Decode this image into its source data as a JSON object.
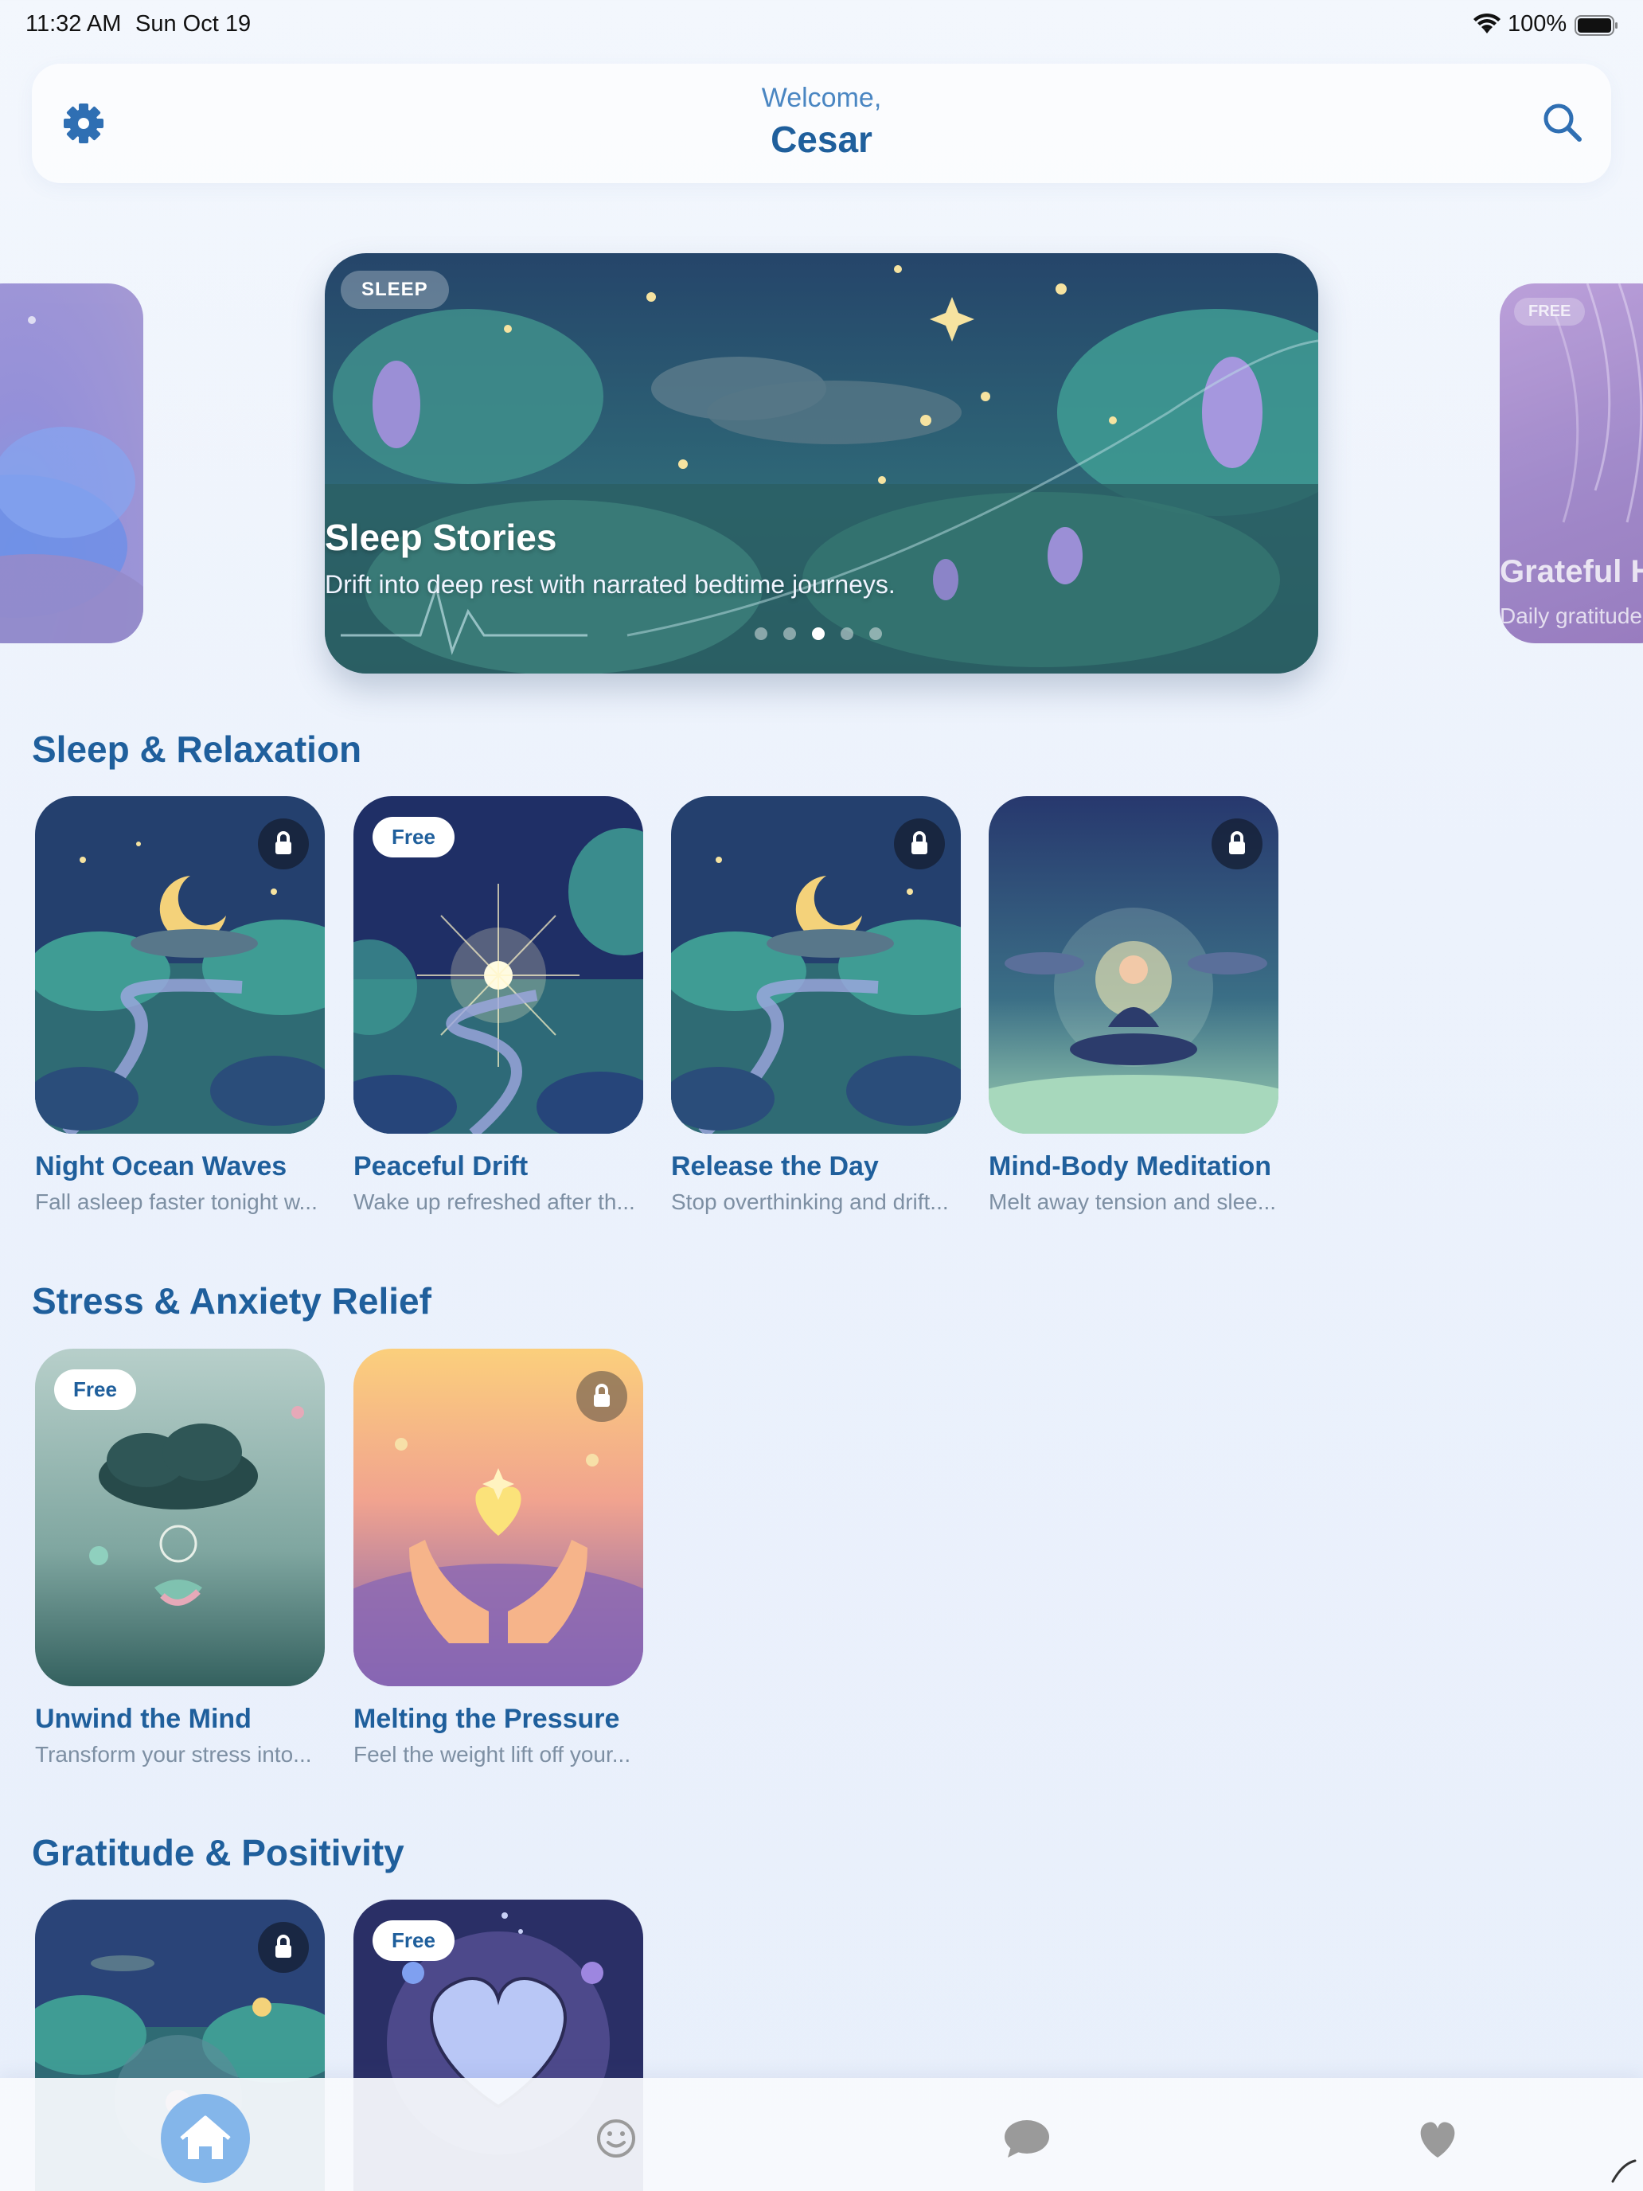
{
  "status_bar": {
    "time": "11:32 AM",
    "date": "Sun Oct 19",
    "battery": "100%"
  },
  "header": {
    "welcome": "Welcome,",
    "user_name": "Cesar"
  },
  "carousel": {
    "active_index": 2,
    "count": 5,
    "hero": {
      "badge": "SLEEP",
      "title": "Sleep Stories",
      "subtitle": "Drift into deep rest with narrated bedtime journeys."
    },
    "next": {
      "badge": "FREE",
      "title": "Grateful H",
      "subtitle": "Daily gratitude"
    }
  },
  "sections": [
    {
      "title": "Sleep & Relaxation",
      "items": [
        {
          "title": "Night Ocean Waves",
          "subtitle": "Fall asleep faster tonight w...",
          "locked": true,
          "free": false
        },
        {
          "title": "Peaceful Drift",
          "subtitle": "Wake up refreshed after th...",
          "locked": false,
          "free": true
        },
        {
          "title": "Release the Day",
          "subtitle": "Stop overthinking and drift...",
          "locked": true,
          "free": false
        },
        {
          "title": "Mind-Body Meditation",
          "subtitle": "Melt away tension and slee...",
          "locked": true,
          "free": false
        }
      ]
    },
    {
      "title": "Stress & Anxiety Relief",
      "items": [
        {
          "title": "Unwind the Mind",
          "subtitle": "Transform your stress into...",
          "locked": false,
          "free": true
        },
        {
          "title": "Melting the Pressure",
          "subtitle": "Feel the weight lift off your...",
          "locked": true,
          "free": false
        }
      ]
    },
    {
      "title": "Gratitude & Positivity",
      "items": [
        {
          "locked": true,
          "free": false
        },
        {
          "locked": false,
          "free": true
        }
      ]
    }
  ],
  "free_label": "Free",
  "tabs": [
    {
      "icon": "home-icon",
      "active": true
    },
    {
      "icon": "smiley-icon",
      "active": false
    },
    {
      "icon": "chat-bubble-icon",
      "active": false
    },
    {
      "icon": "heart-icon",
      "active": false
    }
  ],
  "colors": {
    "accent": "#1f5f9c",
    "tab_active": "#84b6ea"
  }
}
